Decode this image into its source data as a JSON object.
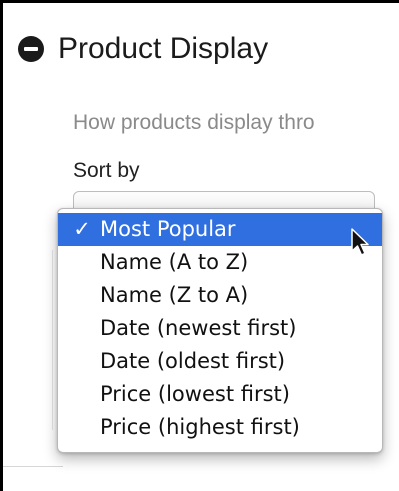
{
  "section": {
    "title": "Product Display",
    "collapse_icon": "minus-circle-icon",
    "description": "How products display thro",
    "sort_label": "Sort by"
  },
  "sort_dropdown": {
    "selected": "Most Popular",
    "check_glyph": "✓",
    "options": [
      {
        "label": "Most Popular",
        "selected": true
      },
      {
        "label": "Name (A to Z)",
        "selected": false
      },
      {
        "label": "Name (Z to A)",
        "selected": false
      },
      {
        "label": "Date (newest first)",
        "selected": false
      },
      {
        "label": "Date (oldest first)",
        "selected": false
      },
      {
        "label": "Price (lowest first)",
        "selected": false
      },
      {
        "label": "Price (highest first)",
        "selected": false
      }
    ]
  },
  "colors": {
    "highlight": "#2f6fe0",
    "description_text": "#8a8a8a",
    "title_text": "#1b1b1b"
  },
  "cursor_icon": "mouse-pointer-icon"
}
